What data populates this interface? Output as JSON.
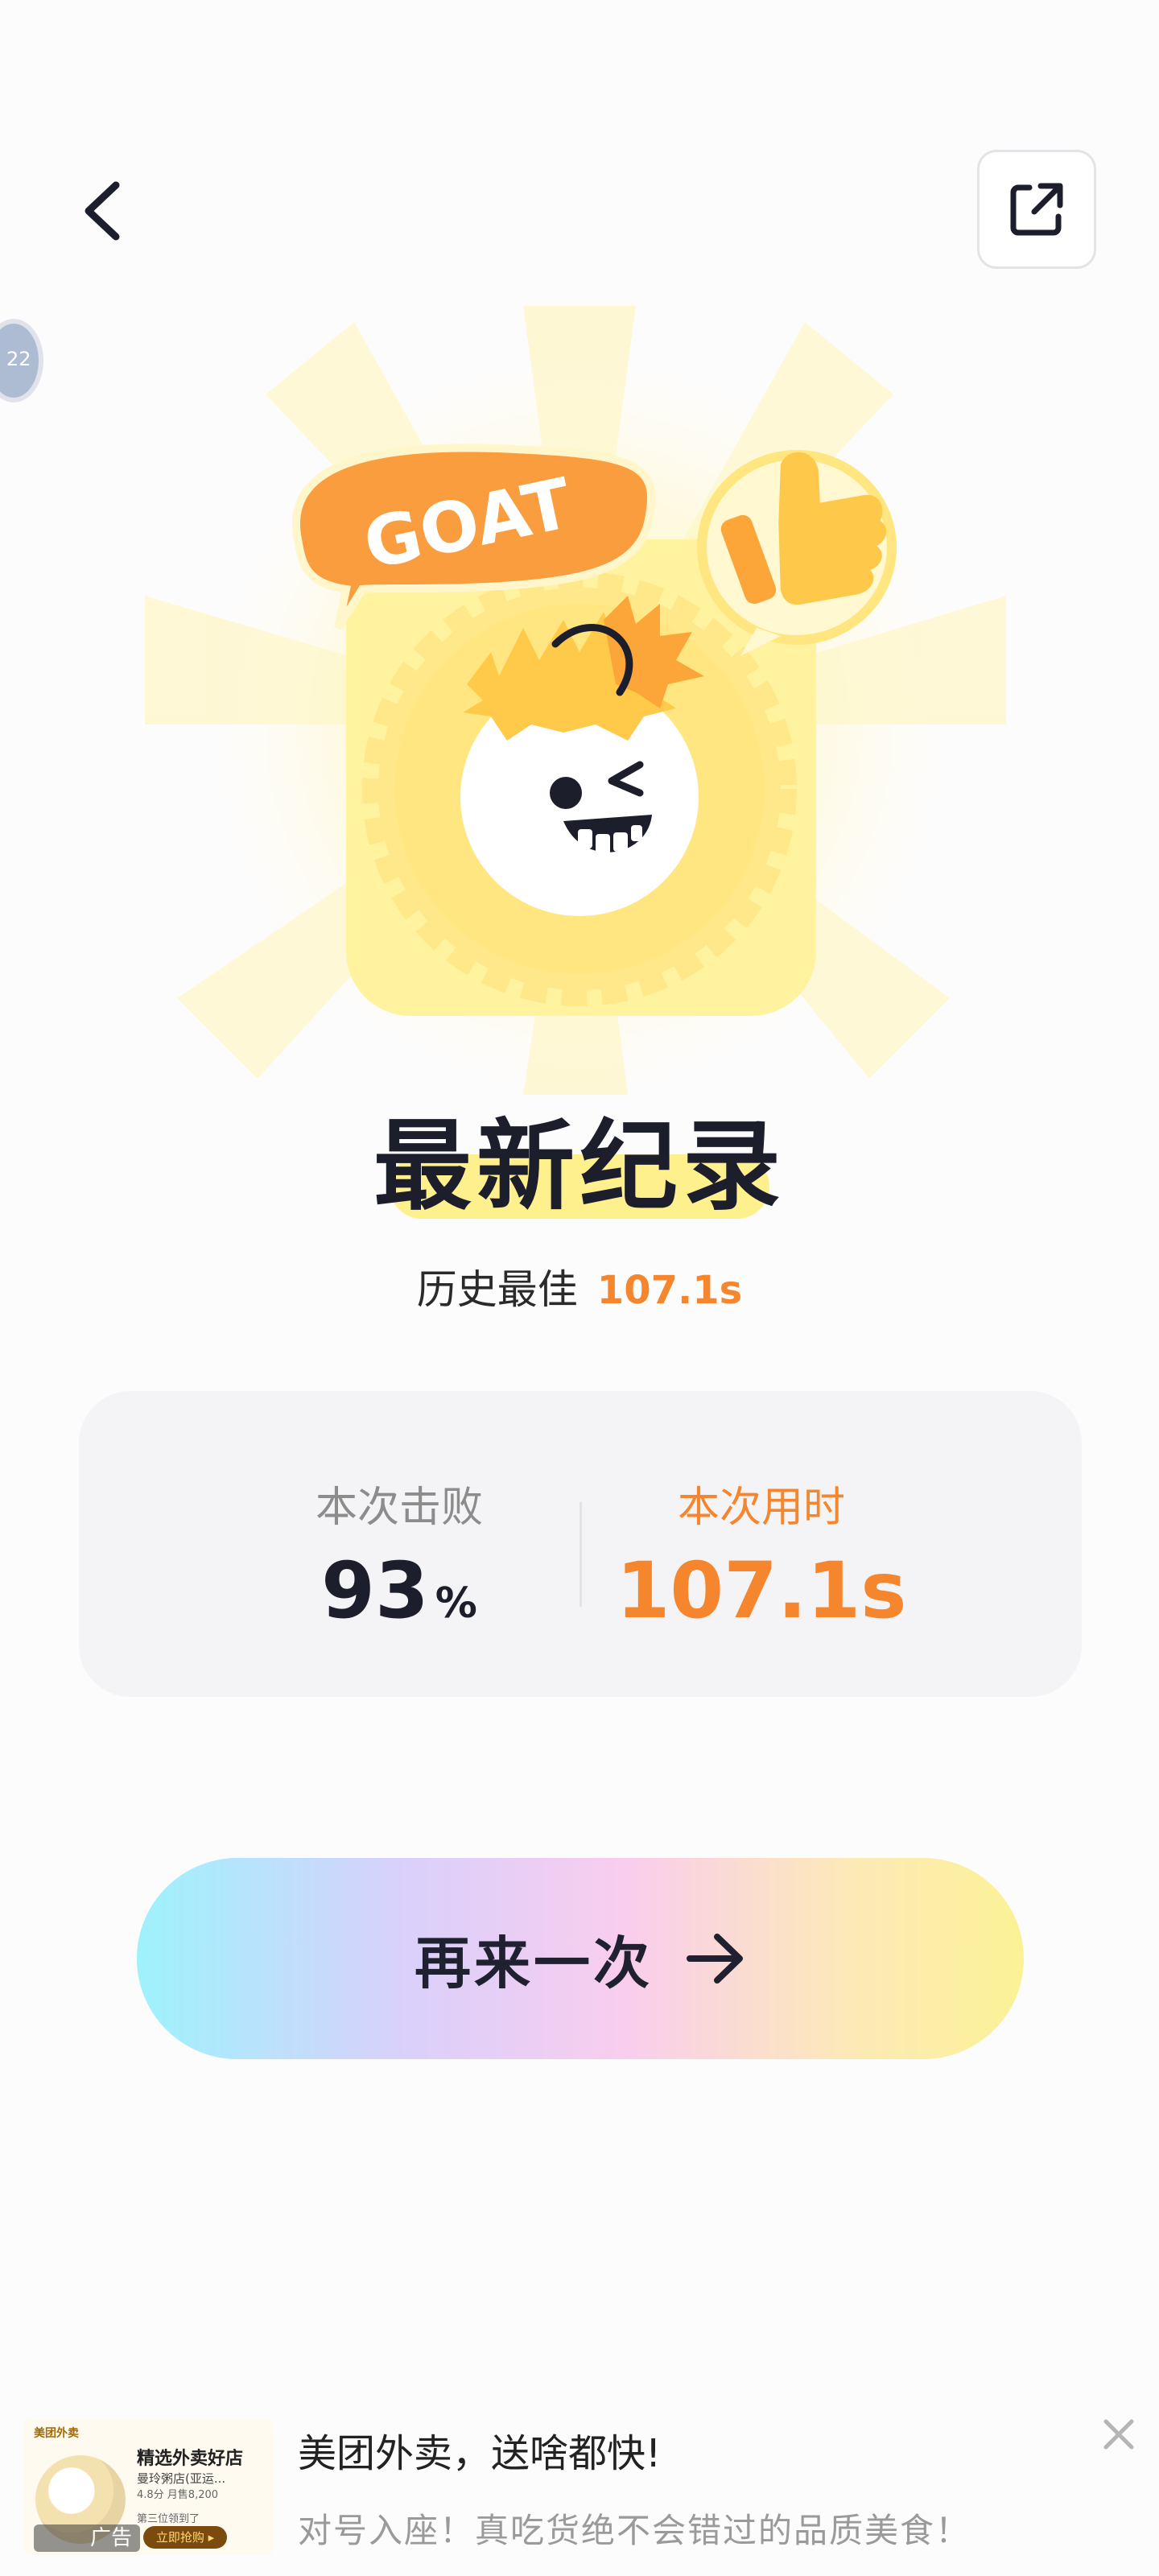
{
  "header": {
    "back_icon": "chevron-left-icon",
    "share_icon": "share-external-icon"
  },
  "side_bubble": {
    "text": "22"
  },
  "hero": {
    "badge_text": "GOAT",
    "thumb_icon": "thumbs-up-icon",
    "colors": {
      "orange": "#FA9D3E",
      "yellow": "#FFE680",
      "cream": "#FFF3A8"
    }
  },
  "record": {
    "title": "最新纪录",
    "best_label": "历史最佳",
    "best_value": "107.1s"
  },
  "stats": {
    "defeated_label": "本次击败",
    "defeated_value": "93",
    "defeated_unit": "%",
    "time_label": "本次用时",
    "time_value": "107.1s"
  },
  "retry": {
    "label": "再来一次",
    "icon": "arrow-right-icon"
  },
  "ad": {
    "thumb_title": "精选外卖好店",
    "thumb_line1": "曼玲粥店(亚运...",
    "thumb_line2": "4.8分  月售8,200",
    "thumb_line3": "第三位领到了",
    "thumb_cta": "立即抢购 ▸",
    "thumb_brand": "美团外卖",
    "tag": "广告",
    "title": "美团外卖，送啥都快!",
    "description": "对号入座！真吃货绝不会错过的品质美食！",
    "close_icon": "close-icon"
  },
  "colors": {
    "accent_orange": "#F5862D",
    "title_dark": "#1D1E2C",
    "title_highlight": "#FFF08E"
  }
}
